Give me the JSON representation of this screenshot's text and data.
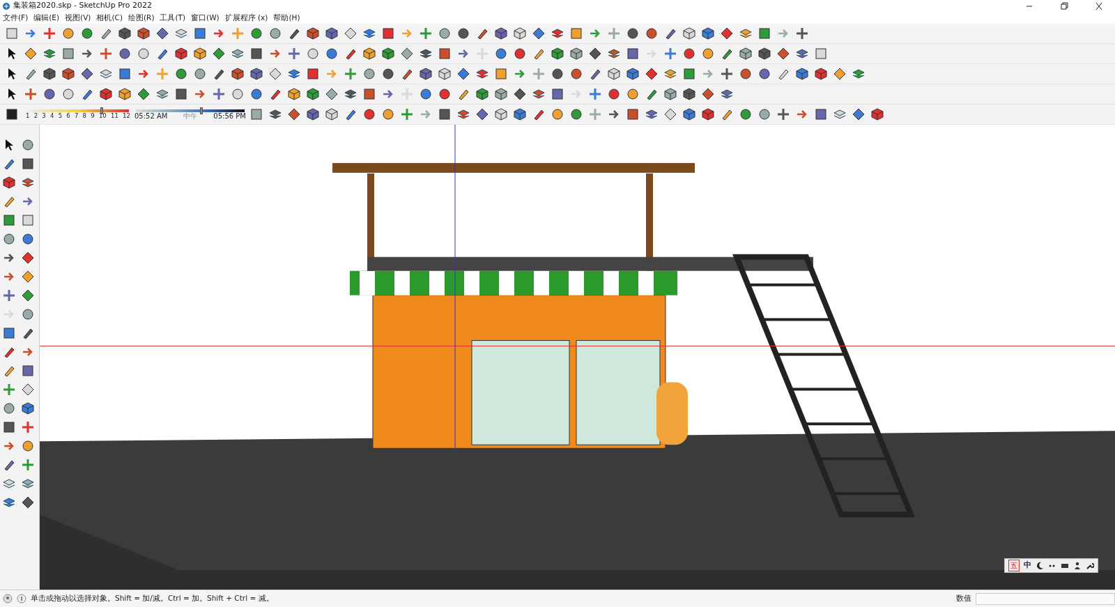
{
  "window": {
    "title": "集装箱2020.skp - SketchUp Pro 2022"
  },
  "menu": [
    "文件(F)",
    "编辑(E)",
    "视图(V)",
    "相机(C)",
    "绘图(R)",
    "工具(T)",
    "窗口(W)",
    "扩展程序 (x)",
    "帮助(H)"
  ],
  "shadows": {
    "months": [
      "1",
      "2",
      "3",
      "4",
      "5",
      "6",
      "7",
      "8",
      "9",
      "10",
      "11",
      "12"
    ],
    "month_slider": {
      "level": 0.73
    },
    "time_start": "05:52 AM",
    "time_mid": "中午",
    "time_end": "05:56 PM",
    "time_slider": {
      "level": 0.6
    }
  },
  "status_bar": {
    "hint": "单击或拖动以选择对象。Shift = 加/减。Ctrl = 加。Shift + Ctrl = 减。",
    "measure_label": "数值"
  },
  "ime_bar": {
    "mode": "中",
    "layout": "五"
  }
}
